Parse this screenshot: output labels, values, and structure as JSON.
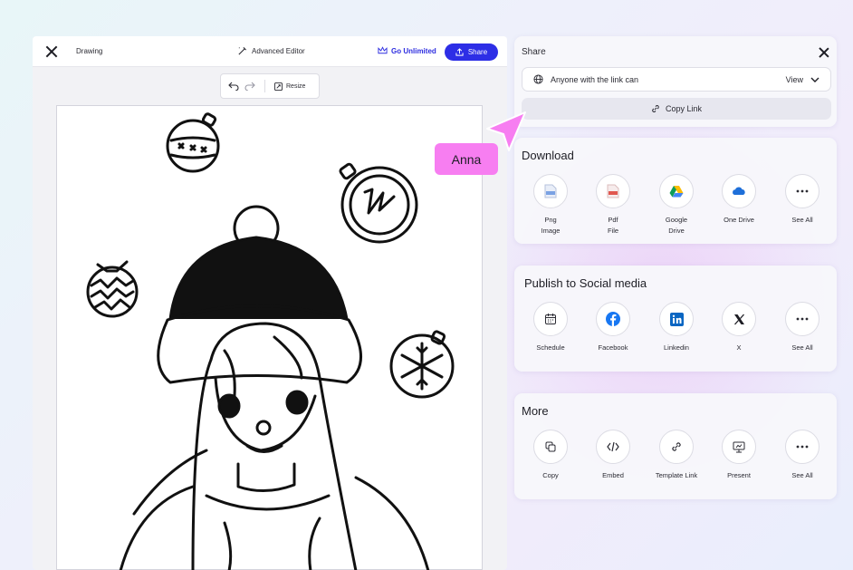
{
  "editor": {
    "doc_title": "Drawing",
    "advanced_editor_label": "Advanced Editor",
    "go_unlimited_label": "Go Unlimited",
    "share_button_label": "Share",
    "resize_label": "Resize"
  },
  "share_panel": {
    "title": "Share",
    "access_text": "Anyone with the link can",
    "permission": "View",
    "copy_link_label": "Copy Link"
  },
  "download": {
    "title": "Download",
    "items": [
      {
        "label": "Png\nImage",
        "icon": "png-file-icon"
      },
      {
        "label": "Pdf\nFile",
        "icon": "pdf-file-icon"
      },
      {
        "label": "Google\nDrive",
        "icon": "google-drive-icon"
      },
      {
        "label": "One Drive",
        "icon": "onedrive-icon"
      },
      {
        "label": "See All",
        "icon": "more-dots-icon"
      }
    ]
  },
  "social": {
    "title": "Publish to Social media",
    "items": [
      {
        "label": "Schedule",
        "icon": "calendar-icon"
      },
      {
        "label": "Facebook",
        "icon": "facebook-icon"
      },
      {
        "label": "Linkedin",
        "icon": "linkedin-icon"
      },
      {
        "label": "X",
        "icon": "x-logo-icon"
      },
      {
        "label": "See All",
        "icon": "more-dots-icon"
      }
    ]
  },
  "more": {
    "title": "More",
    "items": [
      {
        "label": "Copy",
        "icon": "copy-icon"
      },
      {
        "label": "Embed",
        "icon": "code-icon"
      },
      {
        "label": "Template Link",
        "icon": "link-icon"
      },
      {
        "label": "Present",
        "icon": "presentation-icon"
      },
      {
        "label": "See All",
        "icon": "more-dots-icon"
      }
    ]
  },
  "collaborator": {
    "name": "Anna",
    "color": "#f77ef1"
  },
  "colors": {
    "accent": "#2d2ee6",
    "facebook": "#1877f2",
    "linkedin": "#0a66c2"
  }
}
